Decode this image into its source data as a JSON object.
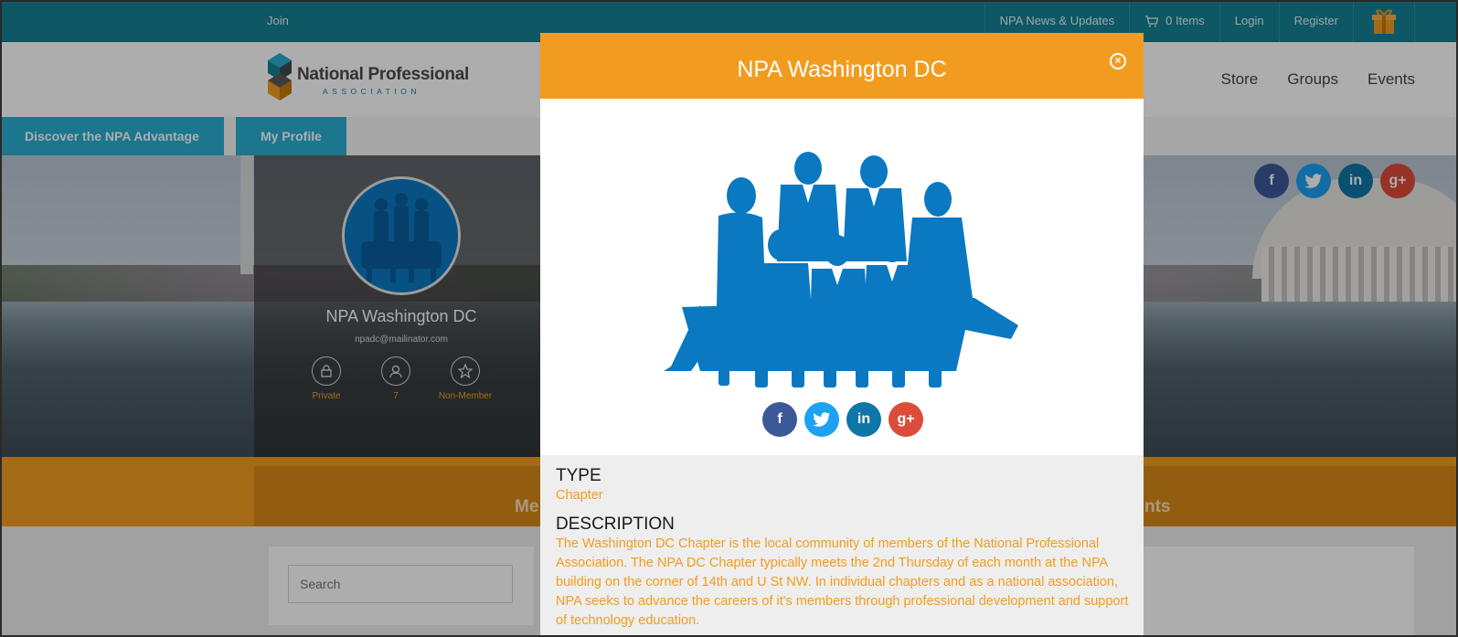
{
  "topbar": {
    "join": "Join",
    "news": "NPA News & Updates",
    "cart": "0 Items",
    "login": "Login",
    "register": "Register"
  },
  "logo": {
    "name": "National Professional",
    "sub": "ASSOCIATION"
  },
  "mainnav": [
    "Store",
    "Groups",
    "Events"
  ],
  "subnav": {
    "advantage": "Discover the NPA Advantage",
    "profile": "My Profile"
  },
  "profile": {
    "name": "NPA Washington DC",
    "email": "npadc@mailinator.com",
    "stats": [
      {
        "icon": "lock-icon",
        "label": "Private"
      },
      {
        "icon": "user-icon",
        "label": "7"
      },
      {
        "icon": "star-icon",
        "label": "Non-Member"
      }
    ]
  },
  "band": {
    "left_text": "Me",
    "right_text": "nts"
  },
  "search": {
    "placeholder": "Search"
  },
  "social": [
    "facebook-icon",
    "twitter-icon",
    "linkedin-icon",
    "google-plus-icon"
  ],
  "colors": {
    "teal": "#168196",
    "accent": "#f29c1f",
    "tab": "#2aaed0",
    "silhouette": "#0b78c2"
  },
  "modal": {
    "title": "NPA Washington DC",
    "type_heading": "TYPE",
    "type_value": "Chapter",
    "description_heading": "DESCRIPTION",
    "description": "The Washington DC Chapter is the local community of members of the National Professional Association. The NPA DC Chapter typically meets the 2nd Thursday of each month at the NPA building on the corner of 14th and U St NW. In individual chapters and as a national association, NPA seeks to advance the careers of it's members through professional development and support of technology education."
  }
}
